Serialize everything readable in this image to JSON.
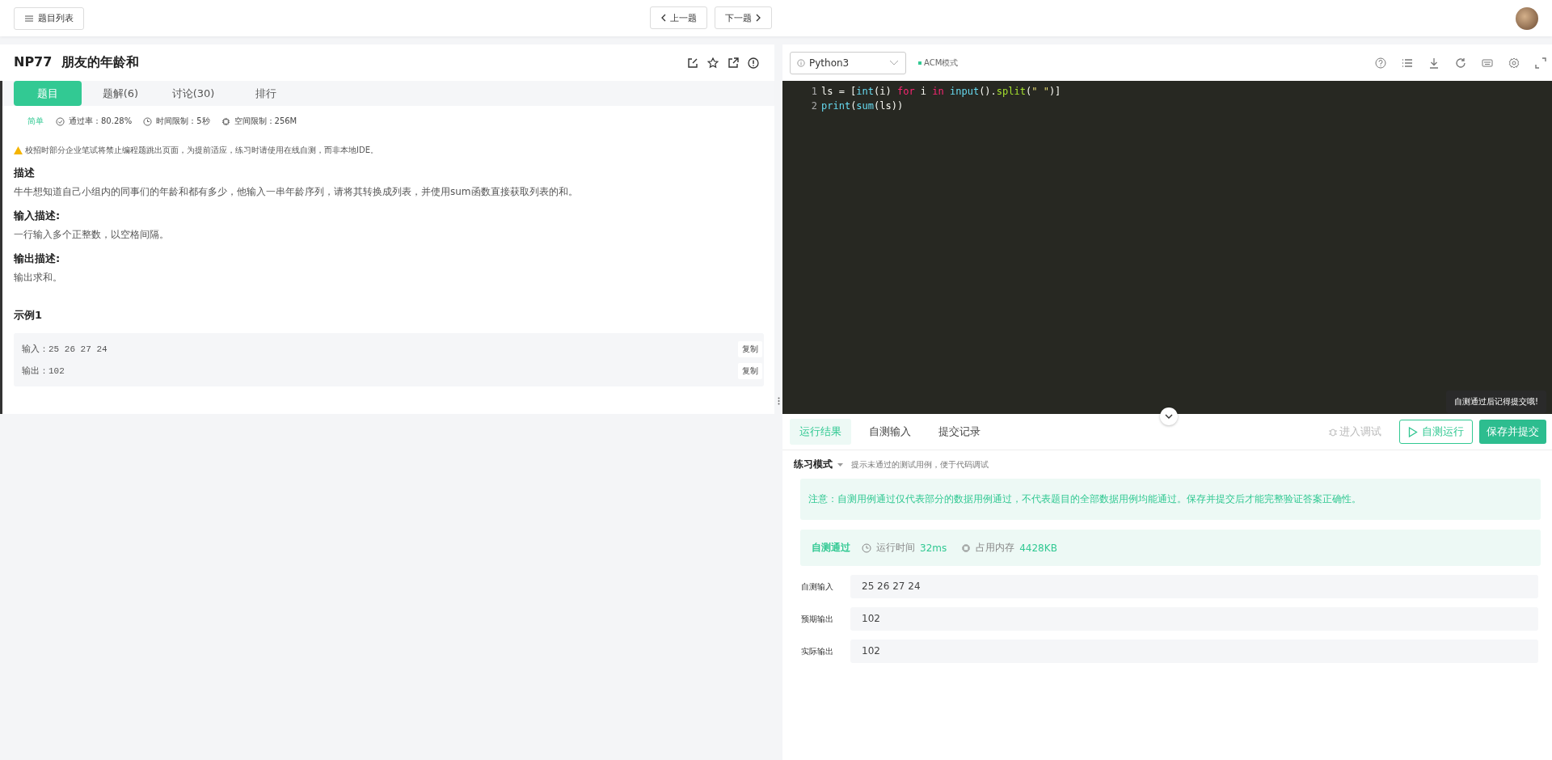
{
  "top_bar": {
    "list_button": "题目列表",
    "prev_button": "上一题",
    "next_button": "下一题"
  },
  "problem": {
    "title": "NP77  朋友的年龄和",
    "tabs": [
      {
        "label": "题目",
        "selected": true
      },
      {
        "label": "题解(6)",
        "selected": false
      },
      {
        "label": "讨论(30)",
        "selected": false
      },
      {
        "label": "排行",
        "selected": false
      }
    ],
    "difficulty": "简单",
    "pass_rate": "通过率：80.28%",
    "time_limit": "时间限制：5秒",
    "space_limit": "空间限制：256M",
    "warning": "校招时部分企业笔试将禁止编程题跳出页面，为提前适应，练习时请使用在线自测，而非本地IDE。",
    "sections": [
      {
        "heading": "描述",
        "text": "牛牛想知道自己小组内的同事们的年龄和都有多少，他输入一串年龄序列，请将其转换成列表，并使用sum函数直接获取列表的和。"
      },
      {
        "heading": "输入描述:",
        "text": "一行输入多个正整数，以空格间隔。"
      },
      {
        "heading": "输出描述:",
        "text": "输出求和。"
      }
    ],
    "example": {
      "heading": "示例1",
      "rows": [
        {
          "text": "输入：25 26 27 24",
          "copy": "复制"
        },
        {
          "text": "输出：102",
          "copy": "复制"
        }
      ]
    }
  },
  "editor": {
    "language": "Python3",
    "mode": "ACM模式",
    "lines": [
      {
        "number": "1",
        "tokens": [
          {
            "kind": "plain",
            "text": "ls = ["
          },
          {
            "kind": "builtin",
            "text": "int"
          },
          {
            "kind": "plain",
            "text": "(i) "
          },
          {
            "kind": "keyword",
            "text": "for"
          },
          {
            "kind": "plain",
            "text": " i "
          },
          {
            "kind": "keyword",
            "text": "in"
          },
          {
            "kind": "builtin",
            "text": " input"
          },
          {
            "kind": "plain",
            "text": "()."
          },
          {
            "kind": "method",
            "text": "split"
          },
          {
            "kind": "plain",
            "text": "("
          },
          {
            "kind": "string",
            "text": "\" \""
          },
          {
            "kind": "plain",
            "text": ")]"
          }
        ]
      },
      {
        "number": "2",
        "tokens": [
          {
            "kind": "builtin",
            "text": "print"
          },
          {
            "kind": "plain",
            "text": "("
          },
          {
            "kind": "builtin",
            "text": "sum"
          },
          {
            "kind": "plain",
            "text": "(ls))"
          }
        ]
      }
    ],
    "tooltip": "自测通过后记得提交哦!"
  },
  "results": {
    "tabs": [
      {
        "label": "运行结果",
        "selected": true
      },
      {
        "label": "自测输入",
        "selected": false
      },
      {
        "label": "提交记录",
        "selected": false
      }
    ],
    "debug_button": "进入调试",
    "run_button": "自测运行",
    "submit_button": "保存并提交",
    "mode": "练习模式",
    "mode_hint": "提示未通过的测试用例，便于代码调试",
    "notice": "注意：自测用例通过仅代表部分的数据用例通过，不代表题目的全部数据用例均能通过。保存并提交后才能完整验证答案正确性。",
    "status": "自测通过",
    "time_label": "运行时间",
    "time_value": "32ms",
    "memory_label": "占用内存",
    "memory_value": "4428KB",
    "rows": [
      {
        "label": "自测输入",
        "value": "25 26 27 24"
      },
      {
        "label": "预期输出",
        "value": "102"
      },
      {
        "label": "实际输出",
        "value": "102"
      }
    ]
  }
}
